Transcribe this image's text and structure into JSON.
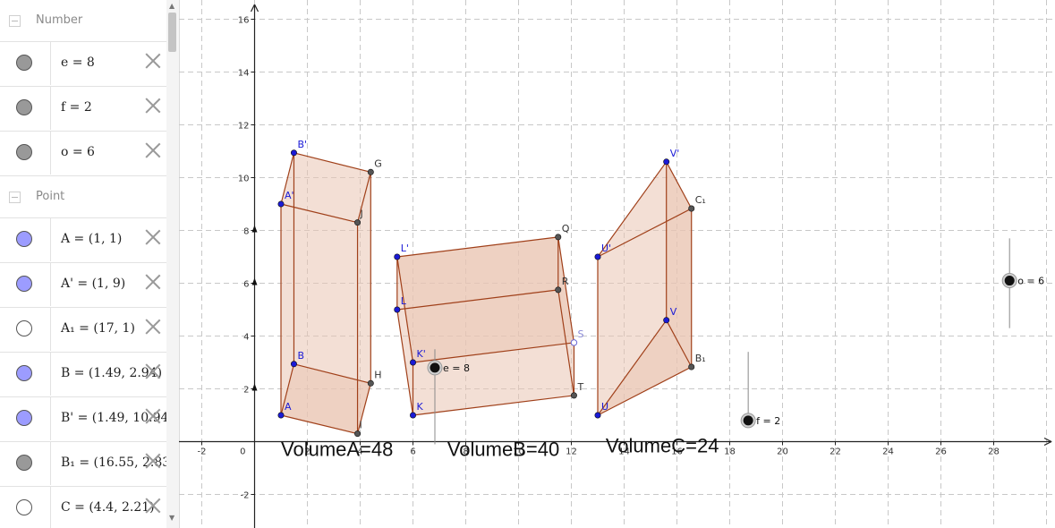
{
  "algebra": {
    "sections": [
      {
        "name": "Number",
        "rows": [
          {
            "text": "e = 8",
            "marble": "#999999"
          },
          {
            "text": "f = 2",
            "marble": "#999999"
          },
          {
            "text": "o = 6",
            "marble": "#999999"
          }
        ]
      },
      {
        "name": "Point",
        "rows": [
          {
            "text": "A = (1, 1)",
            "marble": "#9c9cff"
          },
          {
            "text": "A' = (1, 9)",
            "marble": "#9c9cff"
          },
          {
            "text": "A₁ = (17, 1)",
            "marble": "#ffffff"
          },
          {
            "text": "B = (1.49, 2.94)",
            "marble": "#9c9cff"
          },
          {
            "text": "B' = (1.49, 10.94)",
            "marble": "#9c9cff"
          },
          {
            "text": "B₁ = (16.55, 2.83)",
            "marble": "#999999"
          },
          {
            "text": "C = (4.4, 2.21)",
            "marble": "#ffffff"
          }
        ]
      }
    ]
  },
  "graphics": {
    "x_ticks": [
      "-2",
      "0",
      "2",
      "4",
      "6",
      "8",
      "10",
      "12",
      "14",
      "16",
      "18",
      "20",
      "22",
      "24",
      "26",
      "28"
    ],
    "y_ticks": [
      "16",
      "14",
      "12",
      "10",
      "8",
      "6",
      "4",
      "2",
      "-2"
    ],
    "volume_labels": [
      {
        "text": "VolumeA=48",
        "x": 1.0,
        "y": -0.55
      },
      {
        "text": "VolumeB=40",
        "x": 7.3,
        "y": -0.55
      },
      {
        "text": "VolumeC=24",
        "x": 13.3,
        "y": -0.4
      }
    ],
    "sliders": [
      {
        "label": "e = 8",
        "x": 6.83,
        "y": 2.8,
        "line_from": -0.1,
        "line_to": 3.5
      },
      {
        "label": "f = 2",
        "x": 18.7,
        "y": 0.8,
        "line_from": 0.8,
        "line_to": 3.4
      },
      {
        "label": "o = 6",
        "x": 28.6,
        "y": 6.1,
        "line_from": 4.3,
        "line_to": 7.7
      }
    ],
    "colors": {
      "face_fill": "#e9c4b3",
      "edge": "#a0401a",
      "point_blue": "#1a1ad6",
      "point_gray": "#555555",
      "grid": "#c8c8c8"
    },
    "prisms": [
      {
        "points": {
          "A": [
            1,
            1
          ],
          "B": [
            1.49,
            2.94
          ],
          "H": [
            4.4,
            2.21
          ],
          "I": [
            3.9,
            0.3
          ],
          "A'": [
            1,
            9
          ],
          "B'": [
            1.49,
            10.94
          ],
          "G": [
            4.4,
            10.21
          ],
          "J": [
            3.9,
            8.3
          ]
        },
        "faces": [
          [
            "A",
            "B",
            "H",
            "I"
          ],
          [
            "A'",
            "B'",
            "G",
            "J"
          ],
          [
            "A",
            "A'",
            "J",
            "I"
          ],
          [
            "I",
            "J",
            "G",
            "H"
          ]
        ],
        "edges": [
          [
            "A",
            "B"
          ],
          [
            "B",
            "H"
          ],
          [
            "H",
            "I"
          ],
          [
            "I",
            "A"
          ],
          [
            "A'",
            "B'"
          ],
          [
            "B'",
            "G"
          ],
          [
            "G",
            "J"
          ],
          [
            "J",
            "A'"
          ],
          [
            "A",
            "A'"
          ],
          [
            "B",
            "B'"
          ],
          [
            "H",
            "G"
          ],
          [
            "I",
            "J"
          ]
        ],
        "labels": [
          {
            "name": "A",
            "dx": 4,
            "dy": -6,
            "color": "#1a1ad6"
          },
          {
            "name": "B",
            "dx": 4,
            "dy": -6,
            "color": "#1a1ad6"
          },
          {
            "name": "A'",
            "dx": 4,
            "dy": -6,
            "color": "#1a1ad6"
          },
          {
            "name": "B'",
            "dx": 4,
            "dy": -6,
            "color": "#1a1ad6"
          },
          {
            "name": "G",
            "dx": 4,
            "dy": -6,
            "color": "#333333"
          },
          {
            "name": "J",
            "dx": 3,
            "dy": -6,
            "color": "#333333"
          },
          {
            "name": "H",
            "dx": 4,
            "dy": -6,
            "color": "#333333"
          },
          {
            "name": "I",
            "dx": 2,
            "dy": -6,
            "color": "#333333"
          }
        ],
        "point_colors": {
          "A": "#1a1ad6",
          "B": "#1a1ad6",
          "A'": "#1a1ad6",
          "B'": "#1a1ad6",
          "G": "#555555",
          "J": "#555555",
          "H": "#555555",
          "I": "#555555"
        }
      },
      {
        "points": {
          "K": [
            6,
            1
          ],
          "K'": [
            6,
            3
          ],
          "T": [
            12.1,
            1.75
          ],
          "S": [
            12.1,
            3.75
          ],
          "L": [
            5.4,
            5
          ],
          "L'": [
            5.4,
            7
          ],
          "R": [
            11.5,
            5.75
          ],
          "Q": [
            11.5,
            7.75
          ]
        },
        "faces": [
          [
            "K",
            "T",
            "R",
            "L"
          ],
          [
            "K'",
            "S",
            "Q",
            "L'"
          ],
          [
            "L",
            "R",
            "Q",
            "L'"
          ],
          [
            "T",
            "S",
            "Q",
            "R"
          ]
        ],
        "edges": [
          [
            "K",
            "T"
          ],
          [
            "T",
            "R"
          ],
          [
            "R",
            "L"
          ],
          [
            "L",
            "K"
          ],
          [
            "K'",
            "S"
          ],
          [
            "S",
            "Q"
          ],
          [
            "Q",
            "L'"
          ],
          [
            "L'",
            "K'"
          ],
          [
            "K",
            "K'"
          ],
          [
            "T",
            "S"
          ],
          [
            "R",
            "Q"
          ],
          [
            "L",
            "L'"
          ]
        ],
        "labels": [
          {
            "name": "K",
            "dx": 4,
            "dy": -6,
            "color": "#1a1ad6"
          },
          {
            "name": "K'",
            "dx": 4,
            "dy": -6,
            "color": "#1a1ad6"
          },
          {
            "name": "L",
            "dx": 4,
            "dy": -6,
            "color": "#1a1ad6"
          },
          {
            "name": "L'",
            "dx": 4,
            "dy": -6,
            "color": "#1a1ad6"
          },
          {
            "name": "Q",
            "dx": 4,
            "dy": -6,
            "color": "#333333"
          },
          {
            "name": "R",
            "dx": 4,
            "dy": -6,
            "color": "#333333"
          },
          {
            "name": "T",
            "dx": 4,
            "dy": -6,
            "color": "#333333"
          },
          {
            "name": "S",
            "dx": 4,
            "dy": -6,
            "color": "#8a8ad6"
          }
        ],
        "point_colors": {
          "K": "#1a1ad6",
          "K'": "#1a1ad6",
          "L": "#1a1ad6",
          "L'": "#1a1ad6",
          "Q": "#555555",
          "R": "#555555",
          "T": "#555555",
          "S": "#ffffff"
        }
      },
      {
        "points": {
          "U": [
            13,
            1
          ],
          "V": [
            15.6,
            4.6
          ],
          "B₁": [
            16.55,
            2.83
          ],
          "U'": [
            13,
            7
          ],
          "V'": [
            15.6,
            10.6
          ],
          "C₁": [
            16.55,
            8.83
          ]
        },
        "faces": [
          [
            "U",
            "V",
            "B₁"
          ],
          [
            "U'",
            "V'",
            "C₁"
          ],
          [
            "U",
            "U'",
            "C₁",
            "B₁"
          ],
          [
            "V",
            "V'",
            "C₁",
            "B₁"
          ]
        ],
        "edges": [
          [
            "U",
            "V"
          ],
          [
            "V",
            "B₁"
          ],
          [
            "B₁",
            "U"
          ],
          [
            "U'",
            "V'"
          ],
          [
            "V'",
            "C₁"
          ],
          [
            "C₁",
            "U'"
          ],
          [
            "U",
            "U'"
          ],
          [
            "V",
            "V'"
          ],
          [
            "B₁",
            "C₁"
          ]
        ],
        "labels": [
          {
            "name": "U",
            "dx": 4,
            "dy": -6,
            "color": "#1a1ad6"
          },
          {
            "name": "U'",
            "dx": 4,
            "dy": -6,
            "color": "#1a1ad6"
          },
          {
            "name": "V",
            "dx": 4,
            "dy": -6,
            "color": "#1a1ad6"
          },
          {
            "name": "V'",
            "dx": 4,
            "dy": -6,
            "color": "#1a1ad6"
          },
          {
            "name": "B₁",
            "dx": 4,
            "dy": -6,
            "color": "#333333"
          },
          {
            "name": "C₁",
            "dx": 4,
            "dy": -6,
            "color": "#333333"
          }
        ],
        "point_colors": {
          "U": "#1a1ad6",
          "U'": "#1a1ad6",
          "V": "#1a1ad6",
          "V'": "#1a1ad6",
          "B₁": "#555555",
          "C₁": "#555555"
        }
      }
    ]
  }
}
